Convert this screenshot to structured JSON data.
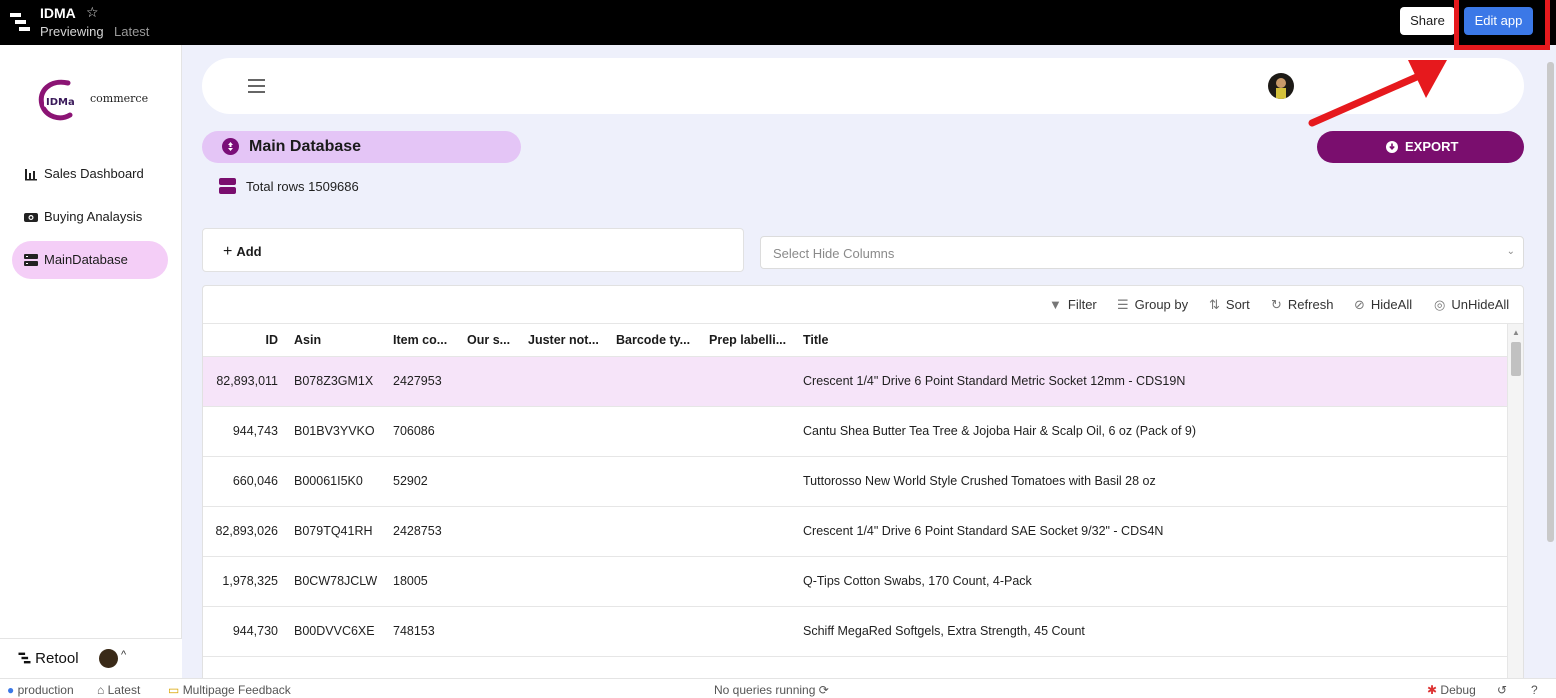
{
  "topbar": {
    "app_name": "IDMA",
    "mode": "Previewing",
    "version": "Latest",
    "share_label": "Share",
    "edit_label": "Edit app"
  },
  "sidebar": {
    "brand_word": "commerce",
    "brand_mark": "IDMa",
    "items": [
      {
        "label": "Sales Dashboard",
        "icon": "bar-chart-icon",
        "active": false
      },
      {
        "label": "Buying Analaysis",
        "icon": "camera-icon",
        "active": false
      },
      {
        "label": "MainDatabase",
        "icon": "database-icon",
        "active": true
      }
    ],
    "footer_logo": "Retool"
  },
  "main": {
    "page_title": "Main Database",
    "export_label": "EXPORT",
    "total_rows_text": "Total rows 1509686",
    "add_label": "Add",
    "hide_columns_placeholder": "Select Hide Columns"
  },
  "table": {
    "toolbar": [
      "Filter",
      "Group by",
      "Sort",
      "Refresh",
      "HideAll",
      "UnHideAll"
    ],
    "columns": [
      "ID",
      "Asin",
      "Item co...",
      "Our s...",
      "Juster not...",
      "Barcode ty...",
      "Prep labelli...",
      "Title"
    ],
    "rows": [
      {
        "id": "82,893,011",
        "asin": "B078Z3GM1X",
        "item": "2427953",
        "title": "Crescent 1/4\" Drive 6 Point Standard Metric Socket 12mm - CDS19N"
      },
      {
        "id": "944,743",
        "asin": "B01BV3YVKO",
        "item": "706086",
        "title": "Cantu Shea Butter Tea Tree & Jojoba Hair & Scalp Oil, 6 oz (Pack of 9)"
      },
      {
        "id": "660,046",
        "asin": "B00061I5K0",
        "item": "52902",
        "title": "Tuttorosso New World Style Crushed Tomatoes with Basil 28 oz"
      },
      {
        "id": "82,893,026",
        "asin": "B079TQ41RH",
        "item": "2428753",
        "title": "Crescent 1/4\" Drive 6 Point Standard SAE Socket 9/32\" - CDS4N"
      },
      {
        "id": "1,978,325",
        "asin": "B0CW78JCLW",
        "item": "18005",
        "title": "Q-Tips Cotton Swabs, 170 Count, 4-Pack"
      },
      {
        "id": "944,730",
        "asin": "B00DVVC6XE",
        "item": "748153",
        "title": "Schiff MegaRed Softgels, Extra Strength, 45 Count"
      }
    ]
  },
  "statusbar": {
    "env": "production",
    "version": "Latest",
    "feedback": "Multipage Feedback",
    "queries": "No queries running",
    "debug": "Debug"
  },
  "colors": {
    "accent": "#7a0e6e",
    "active_nav": "#f4cef7",
    "edit_button": "#3b78e7",
    "annotation_red": "#e6191d"
  }
}
